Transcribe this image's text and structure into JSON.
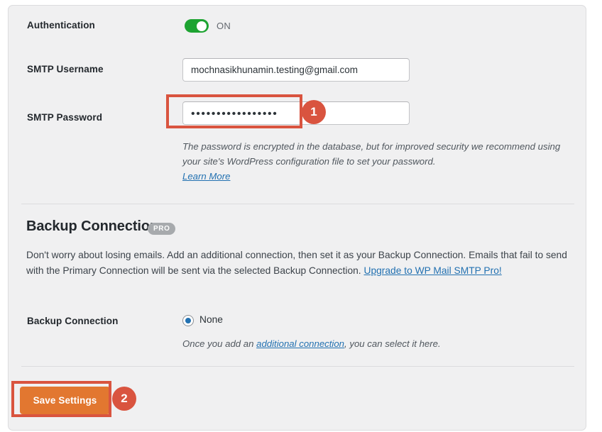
{
  "card": {
    "authentication": {
      "label": "Authentication",
      "toggle_state": "ON",
      "toggle_color": "#1da331",
      "toggle_on": true
    },
    "smtp_username": {
      "label": "SMTP Username",
      "value": "mochnasikhunamin.testing@gmail.com",
      "placeholder": "smtp@example.com"
    },
    "smtp_password": {
      "label": "SMTP Password",
      "masked_value": "•••••••••••••••••",
      "placeholder": "",
      "help_line1": "The password is encrypted in the database, but for improved security we recommend using",
      "help_line2": "your site's WordPress configuration file to set your password.",
      "help_link": "Learn More"
    },
    "backup_section": {
      "title": "Backup Connection",
      "pro_badge": "PRO",
      "description_part1": "Don't worry about losing emails. Add an additional connection, then set it as your Backup Connection. Emails that fail to send with the Primary Connection will be sent via the selected Backup Connection. ",
      "description_link": "Upgrade to WP Mail SMTP Pro!"
    },
    "backup_connection": {
      "label": "Backup Connection",
      "option_none": "None",
      "selected": "None",
      "help_prefix": "Once you add an ",
      "help_link": "additional connection",
      "help_suffix": ", you can select it here."
    },
    "save": {
      "label": "Save Settings"
    }
  },
  "annotations": {
    "accent_color": "#d9543f",
    "badge_1": "1",
    "badge_2": "2"
  }
}
